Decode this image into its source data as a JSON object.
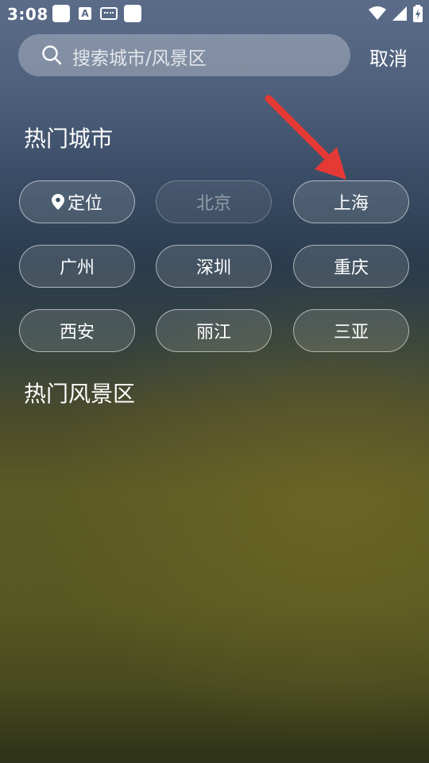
{
  "status_bar": {
    "time": "3:08",
    "icons_left": [
      "app-square-icon",
      "font-a-icon",
      "keyboard-icon",
      "app-square-icon"
    ],
    "icons_right": [
      "wifi-icon",
      "signal-icon",
      "battery-icon"
    ]
  },
  "search": {
    "placeholder": "搜索城市/风景区",
    "cancel_label": "取消"
  },
  "hot_cities": {
    "title": "热门城市",
    "items": [
      {
        "label": "定位",
        "icon": "location-pin-icon",
        "enabled": true
      },
      {
        "label": "北京",
        "enabled": false
      },
      {
        "label": "上海",
        "enabled": true
      },
      {
        "label": "广州",
        "enabled": true
      },
      {
        "label": "深圳",
        "enabled": true
      },
      {
        "label": "重庆",
        "enabled": true
      },
      {
        "label": "西安",
        "enabled": true
      },
      {
        "label": "丽江",
        "enabled": true
      },
      {
        "label": "三亚",
        "enabled": true
      }
    ]
  },
  "hot_scenic": {
    "title": "热门风景区"
  },
  "annotation": {
    "arrow_color": "#e53935",
    "points_to": "上海"
  }
}
